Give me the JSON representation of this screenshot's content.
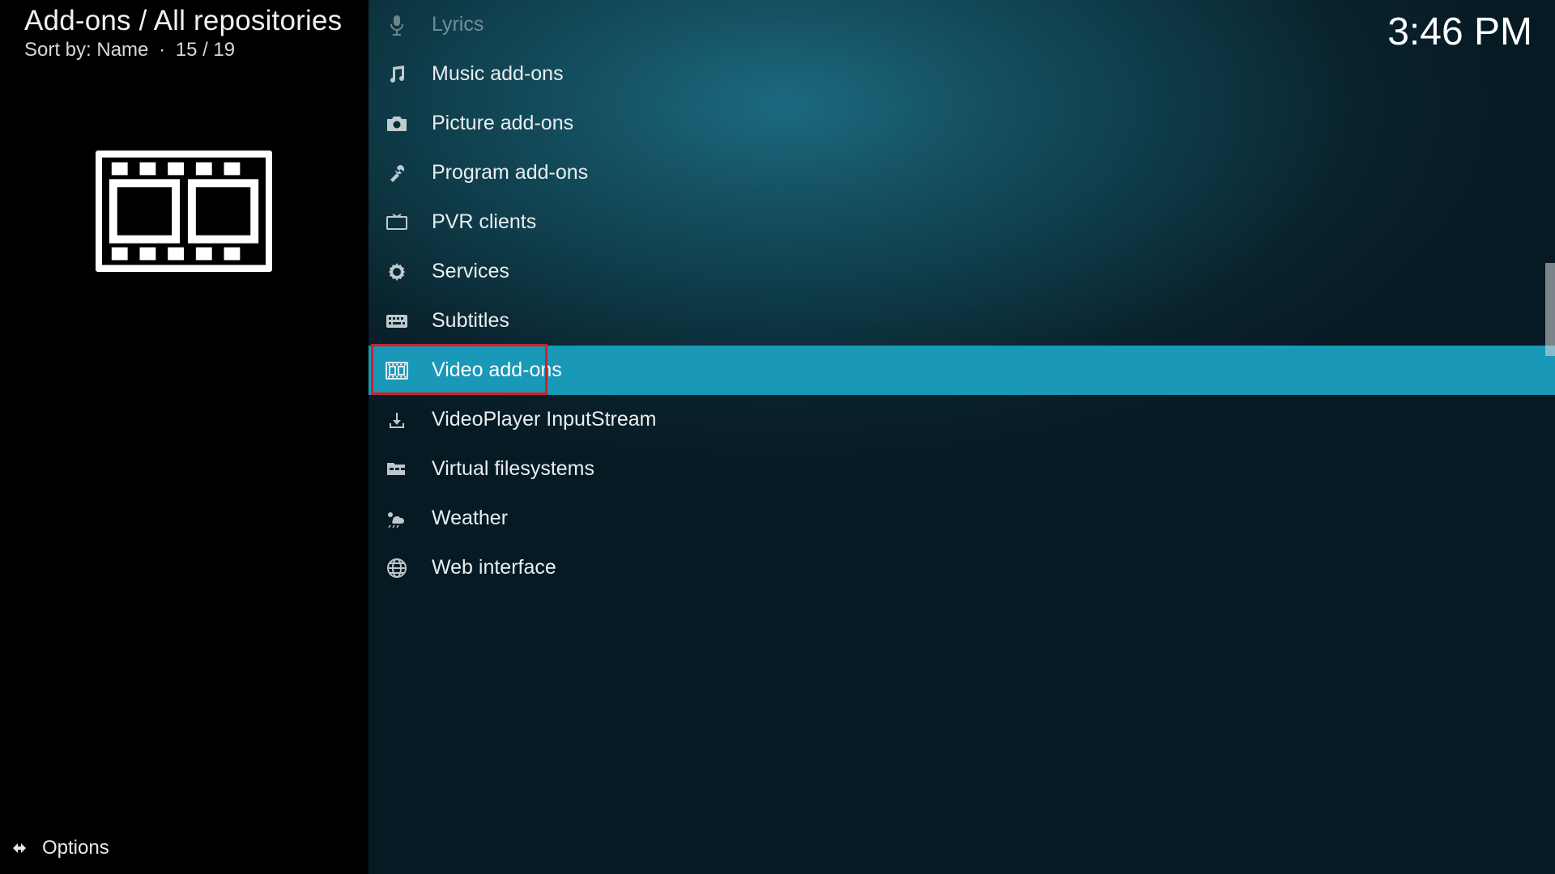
{
  "header": {
    "breadcrumb": "Add-ons / All repositories",
    "sort_label": "Sort by: Name",
    "position": "15 / 19"
  },
  "clock": "3:46 PM",
  "options_label": "Options",
  "selected_index": 7,
  "highlight_index": 7,
  "categories": [
    {
      "id": "lyrics",
      "label": "Lyrics",
      "icon": "microphone-icon",
      "dim": true
    },
    {
      "id": "music-addons",
      "label": "Music add-ons",
      "icon": "music-note-icon",
      "dim": false
    },
    {
      "id": "picture-addons",
      "label": "Picture add-ons",
      "icon": "camera-icon",
      "dim": false
    },
    {
      "id": "program-addons",
      "label": "Program add-ons",
      "icon": "tools-icon",
      "dim": false
    },
    {
      "id": "pvr-clients",
      "label": "PVR clients",
      "icon": "tv-icon",
      "dim": false
    },
    {
      "id": "services",
      "label": "Services",
      "icon": "gear-icon",
      "dim": false
    },
    {
      "id": "subtitles",
      "label": "Subtitles",
      "icon": "keyboard-icon",
      "dim": false
    },
    {
      "id": "video-addons",
      "label": "Video add-ons",
      "icon": "film-icon",
      "dim": false
    },
    {
      "id": "videoplayer-inputstream",
      "label": "VideoPlayer InputStream",
      "icon": "download-icon",
      "dim": false
    },
    {
      "id": "virtual-filesystems",
      "label": "Virtual filesystems",
      "icon": "folder-tree-icon",
      "dim": false
    },
    {
      "id": "weather",
      "label": "Weather",
      "icon": "weather-icon",
      "dim": false
    },
    {
      "id": "web-interface",
      "label": "Web interface",
      "icon": "globe-icon",
      "dim": false
    }
  ]
}
